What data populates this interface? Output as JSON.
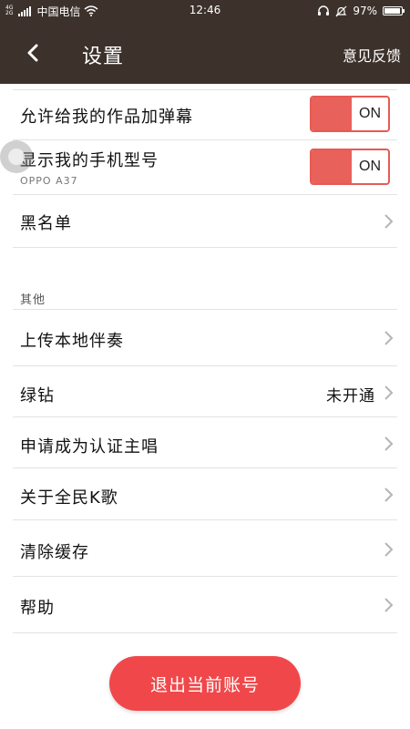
{
  "status_bar": {
    "net_top": "4G",
    "net_bottom": "2G",
    "carrier": "中国电信",
    "time": "12:46",
    "battery": "97%",
    "battery_level": 0.97
  },
  "header": {
    "title": "设置",
    "feedback_label": "意见反馈"
  },
  "settings": {
    "allow_danmaku": {
      "label": "允许给我的作品加弹幕",
      "state": "ON"
    },
    "show_phone_model": {
      "label": "显示我的手机型号",
      "sub": "OPPO A37",
      "state": "ON"
    },
    "blacklist": {
      "label": "黑名单"
    }
  },
  "other_section": {
    "header": "其他",
    "items": [
      {
        "label": "上传本地伴奏",
        "value": ""
      },
      {
        "label": "绿钻",
        "value": "未开通"
      },
      {
        "label": "申请成为认证主唱",
        "value": ""
      },
      {
        "label": "关于全民K歌",
        "value": ""
      },
      {
        "label": "清除缓存",
        "value": ""
      },
      {
        "label": "帮助",
        "value": ""
      }
    ]
  },
  "logout_label": "退出当前账号",
  "colors": {
    "header_bg": "#3c312b",
    "accent": "#e8615a",
    "button": "#f0484a"
  }
}
